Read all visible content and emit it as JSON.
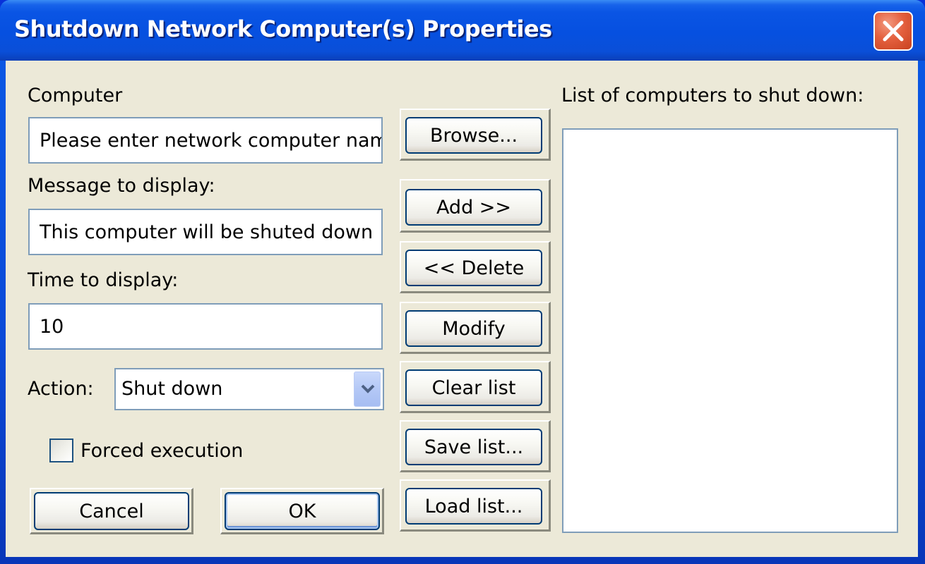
{
  "window": {
    "title": "Shutdown Network Computer(s) Properties",
    "close_icon": "close-icon"
  },
  "form": {
    "computer_label": "Computer",
    "computer_value": "Please enter network computer name",
    "message_label": "Message to display:",
    "message_value": "This computer will be shuted down",
    "time_label": "Time to display:",
    "time_value": "10",
    "action_label": "Action:",
    "action_selected": "Shut down",
    "action_arrow_icon": "chevron-down-icon",
    "forced_label": "Forced execution",
    "forced_checked": false
  },
  "buttons": {
    "browse": "Browse...",
    "add": "Add >>",
    "delete": "<< Delete",
    "modify": "Modify",
    "clear_list": "Clear list",
    "save_list": "Save list...",
    "load_list": "Load list...",
    "cancel": "Cancel",
    "ok": "OK"
  },
  "list": {
    "label": "List of computers to shut down:",
    "items": []
  }
}
